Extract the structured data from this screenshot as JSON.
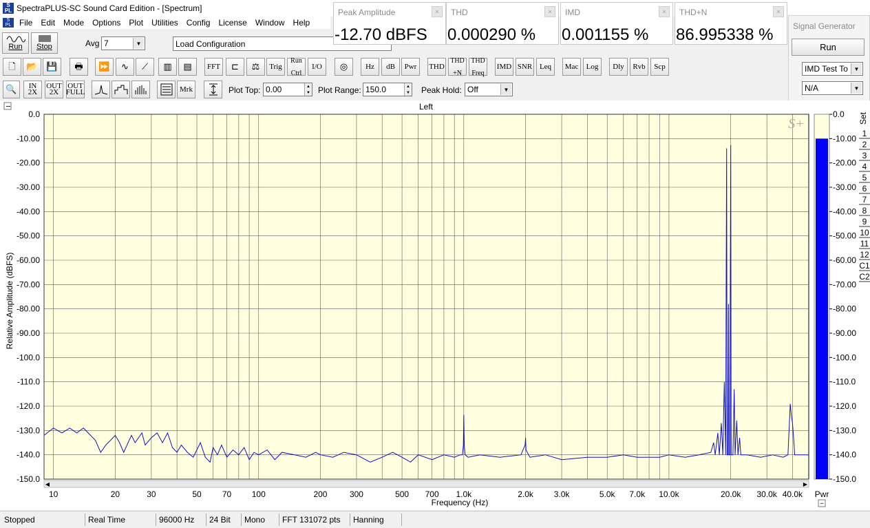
{
  "app": {
    "title": "SpectraPLUS-SC Sound Card Edition - [Spectrum]",
    "menu": [
      "File",
      "Edit",
      "Mode",
      "Options",
      "Plot",
      "Utilities",
      "Config",
      "License",
      "Window",
      "Help"
    ]
  },
  "toolbar1": {
    "run_label": "Run",
    "stop_label": "Stop",
    "avg_label": "Avg",
    "avg_value": "7",
    "load_config": "Load Configuration"
  },
  "toolbar2": [
    "FFT",
    "Trig",
    "Run Ctrl",
    "I/O",
    "Hz",
    "dB",
    "Pwr",
    "THD",
    "THD +N",
    "THD Freq",
    "IMD",
    "SNR",
    "Leq",
    "Mac",
    "Log",
    "Dly",
    "Rvb",
    "Scp"
  ],
  "toolbar3": {
    "mrk": "Mrk",
    "plot_top_label": "Plot Top:",
    "plot_top_value": "0.00",
    "plot_range_label": "Plot Range:",
    "plot_range_value": "150.0",
    "peak_hold_label": "Peak Hold:",
    "peak_hold_value": "Off"
  },
  "meters": [
    {
      "title": "Peak Amplitude",
      "value": "-12.70 dBFS"
    },
    {
      "title": "THD",
      "value": "0.000290 %"
    },
    {
      "title": "IMD",
      "value": "0.001155 %"
    },
    {
      "title": "THD+N",
      "value": "86.995338 %"
    }
  ],
  "signal_generator": {
    "title": "Signal Generator",
    "run_label": "Run",
    "mode": "IMD Test To",
    "option": "N/A"
  },
  "chart_data": {
    "type": "line",
    "title": "Left",
    "xlabel": "Frequency (Hz)",
    "ylabel": "Relative Amplitude (dBFS)",
    "xscale": "log",
    "xlim": [
      9,
      48000
    ],
    "ylim": [
      -150,
      0
    ],
    "grid": true,
    "x_tick_labels": [
      {
        "v": 10,
        "t": "10"
      },
      {
        "v": 20,
        "t": "20"
      },
      {
        "v": 30,
        "t": "30"
      },
      {
        "v": 50,
        "t": "50"
      },
      {
        "v": 70,
        "t": "70"
      },
      {
        "v": 100,
        "t": "100"
      },
      {
        "v": 200,
        "t": "200"
      },
      {
        "v": 300,
        "t": "300"
      },
      {
        "v": 500,
        "t": "500"
      },
      {
        "v": 700,
        "t": "700"
      },
      {
        "v": 1000,
        "t": "1.0k"
      },
      {
        "v": 2000,
        "t": "2.0k"
      },
      {
        "v": 3000,
        "t": "3.0k"
      },
      {
        "v": 5000,
        "t": "5.0k"
      },
      {
        "v": 7000,
        "t": "7.0k"
      },
      {
        "v": 10000,
        "t": "10.0k"
      },
      {
        "v": 20000,
        "t": "20.0k"
      },
      {
        "v": 30000,
        "t": "30.0k"
      },
      {
        "v": 40000,
        "t": "40.0k"
      }
    ],
    "y_tick_labels": [
      "0.0",
      "-10.00",
      "-20.00",
      "-30.00",
      "-40.00",
      "-50.00",
      "-60.00",
      "-70.00",
      "-80.00",
      "-90.00",
      "-100.0",
      "-110.0",
      "-120.0",
      "-130.0",
      "-140.0",
      "-150.0"
    ],
    "series": [
      {
        "points": [
          [
            9,
            -132
          ],
          [
            10,
            -129
          ],
          [
            11,
            -131
          ],
          [
            12,
            -129
          ],
          [
            13,
            -131
          ],
          [
            14,
            -129
          ],
          [
            16,
            -134
          ],
          [
            17,
            -139
          ],
          [
            18,
            -136
          ],
          [
            19,
            -134
          ],
          [
            20,
            -132
          ],
          [
            21,
            -135
          ],
          [
            22,
            -139
          ],
          [
            24,
            -132
          ],
          [
            25,
            -135
          ],
          [
            27,
            -131
          ],
          [
            28,
            -136
          ],
          [
            30,
            -133
          ],
          [
            32,
            -131
          ],
          [
            34,
            -135
          ],
          [
            36,
            -131
          ],
          [
            38,
            -137
          ],
          [
            40,
            -139
          ],
          [
            42,
            -136
          ],
          [
            45,
            -139
          ],
          [
            48,
            -141
          ],
          [
            50,
            -138
          ],
          [
            52,
            -135
          ],
          [
            55,
            -141
          ],
          [
            58,
            -143
          ],
          [
            60,
            -137
          ],
          [
            63,
            -140
          ],
          [
            66,
            -136
          ],
          [
            70,
            -141
          ],
          [
            75,
            -138
          ],
          [
            80,
            -140
          ],
          [
            85,
            -137
          ],
          [
            90,
            -142
          ],
          [
            95,
            -139
          ],
          [
            100,
            -140
          ],
          [
            110,
            -138
          ],
          [
            120,
            -142
          ],
          [
            130,
            -139
          ],
          [
            150,
            -140
          ],
          [
            170,
            -141
          ],
          [
            190,
            -139
          ],
          [
            200,
            -140
          ],
          [
            230,
            -141
          ],
          [
            260,
            -139
          ],
          [
            300,
            -140
          ],
          [
            350,
            -143
          ],
          [
            400,
            -141
          ],
          [
            450,
            -139
          ],
          [
            500,
            -141
          ],
          [
            550,
            -143
          ],
          [
            600,
            -140
          ],
          [
            700,
            -142
          ],
          [
            800,
            -140
          ],
          [
            900,
            -141
          ],
          [
            960,
            -140
          ],
          [
            985,
            -140
          ],
          [
            995,
            -136
          ],
          [
            1000,
            -123.5
          ],
          [
            1005,
            -136
          ],
          [
            1015,
            -140
          ],
          [
            1050,
            -141
          ],
          [
            1200,
            -140
          ],
          [
            1500,
            -141
          ],
          [
            1900,
            -140
          ],
          [
            1990,
            -136
          ],
          [
            2000,
            -133
          ],
          [
            2010,
            -138
          ],
          [
            2100,
            -141
          ],
          [
            2500,
            -140
          ],
          [
            3000,
            -142
          ],
          [
            4000,
            -141
          ],
          [
            5000,
            -141
          ],
          [
            6000,
            -140
          ],
          [
            7000,
            -141
          ],
          [
            8000,
            -141
          ],
          [
            9000,
            -141
          ],
          [
            10000,
            -140
          ],
          [
            12000,
            -141
          ],
          [
            14000,
            -140
          ],
          [
            16000,
            -139
          ],
          [
            16500,
            -135
          ],
          [
            16800,
            -140
          ],
          [
            17300,
            -131
          ],
          [
            17600,
            -140
          ],
          [
            18000,
            -127
          ],
          [
            18300,
            -140
          ],
          [
            18600,
            -110
          ],
          [
            18900,
            -140
          ],
          [
            19000,
            -71
          ],
          [
            19100,
            -14
          ],
          [
            19200,
            -140
          ],
          [
            19400,
            -140
          ],
          [
            19500,
            -78
          ],
          [
            19600,
            -140
          ],
          [
            19800,
            -140
          ],
          [
            19900,
            -70
          ],
          [
            20000,
            -12.7
          ],
          [
            20100,
            -140
          ],
          [
            20500,
            -140
          ],
          [
            20800,
            -113
          ],
          [
            21000,
            -140
          ],
          [
            21400,
            -126
          ],
          [
            21700,
            -140
          ],
          [
            22100,
            -133
          ],
          [
            22400,
            -140
          ],
          [
            24000,
            -140
          ],
          [
            28000,
            -141
          ],
          [
            32000,
            -140
          ],
          [
            36000,
            -141
          ],
          [
            38000,
            -140
          ],
          [
            38500,
            -130
          ],
          [
            39000,
            -119
          ],
          [
            39500,
            -124
          ],
          [
            40000,
            -127
          ],
          [
            40500,
            -133
          ],
          [
            41000,
            -140
          ],
          [
            45000,
            -140
          ],
          [
            48000,
            -140
          ]
        ]
      }
    ]
  },
  "set_panel": {
    "header": "Set",
    "items": [
      "1",
      "2",
      "3",
      "4",
      "5",
      "6",
      "7",
      "8",
      "9",
      "10",
      "11",
      "12",
      "C1",
      "C2"
    ],
    "bottom_label": "Pwr",
    "level": -10.0
  },
  "status": [
    "Stopped",
    "Real Time",
    "96000 Hz",
    "24 Bit",
    "Mono",
    "FFT 131072 pts",
    "Hanning"
  ]
}
